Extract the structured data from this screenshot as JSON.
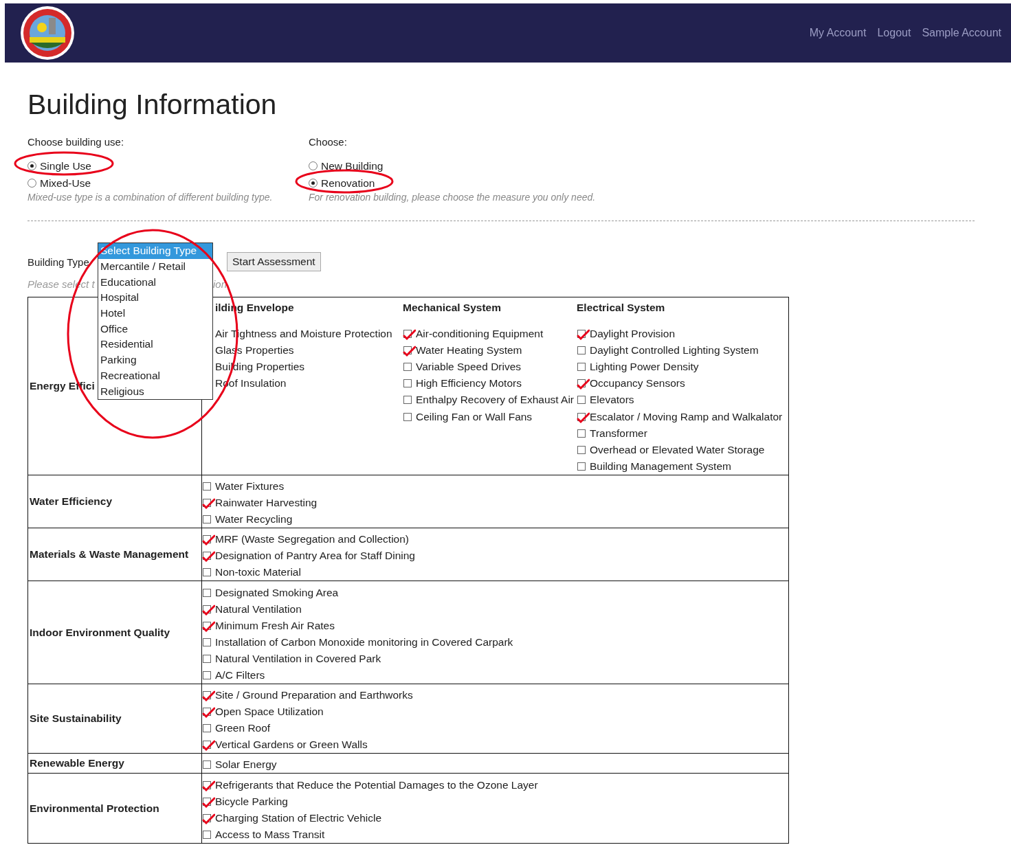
{
  "header": {
    "nav_links": [
      "My Account",
      "Logout",
      "Sample Account"
    ]
  },
  "title": "Building Information",
  "building_use": {
    "label": "Choose building use:",
    "options": [
      {
        "label": "Single Use",
        "selected": true
      },
      {
        "label": "Mixed-Use",
        "selected": false
      }
    ],
    "note": "Mixed-use type is a combination of different building type."
  },
  "project_type": {
    "label": "Choose:",
    "options": [
      {
        "label": "New Building",
        "selected": false
      },
      {
        "label": "Renovation",
        "selected": true
      }
    ],
    "note": "For renovation building, please choose the measure you only need."
  },
  "building_type": {
    "label": "Building Type",
    "button": "Start Assessment",
    "hint_start": "Please select t",
    "hint_end": "ion",
    "dropdown": [
      {
        "label": "Select Building Type",
        "selected": true
      },
      {
        "label": "Mercantile / Retail",
        "selected": false
      },
      {
        "label": "Educational",
        "selected": false
      },
      {
        "label": "Hospital",
        "selected": false
      },
      {
        "label": "Hotel",
        "selected": false
      },
      {
        "label": "Office",
        "selected": false
      },
      {
        "label": "Residential",
        "selected": false
      },
      {
        "label": "Parking",
        "selected": false
      },
      {
        "label": "Recreational",
        "selected": false
      },
      {
        "label": "Religious",
        "selected": false
      }
    ]
  },
  "table": {
    "rows": [
      {
        "category": "Energy Effici",
        "groups": [
          {
            "title": "ilding Envelope",
            "items": [
              {
                "label": "Air Tightness and Moisture Protection"
              },
              {
                "label": "Glass Properties"
              },
              {
                "label": "Building Properties"
              },
              {
                "label": "Roof Insulation"
              }
            ]
          },
          {
            "title": "Mechanical System",
            "items": [
              {
                "label": "Air-conditioning Equipment",
                "checked": true
              },
              {
                "label": "Water Heating System",
                "checked": true
              },
              {
                "label": "Variable Speed Drives",
                "checked": false
              },
              {
                "label": "High Efficiency Motors",
                "checked": false
              },
              {
                "label": "Enthalpy Recovery of Exhaust Air",
                "checked": false
              },
              {
                "label": "Ceiling Fan or Wall Fans",
                "checked": false
              }
            ]
          },
          {
            "title": "Electrical System",
            "items": [
              {
                "label": "Daylight Provision",
                "checked": true
              },
              {
                "label": "Daylight Controlled Lighting System",
                "checked": false
              },
              {
                "label": "Lighting Power Density",
                "checked": false
              },
              {
                "label": "Occupancy Sensors",
                "checked": true
              },
              {
                "label": "Elevators",
                "checked": false
              },
              {
                "label": "Escalator / Moving Ramp and Walkalator",
                "checked": true
              },
              {
                "label": "Transformer",
                "checked": false
              },
              {
                "label": "Overhead or Elevated Water Storage",
                "checked": false
              },
              {
                "label": "Building Management System",
                "checked": false
              }
            ]
          }
        ]
      },
      {
        "category": "Water Efficiency",
        "items": [
          {
            "label": "Water Fixtures",
            "checked": false
          },
          {
            "label": "Rainwater Harvesting",
            "checked": true
          },
          {
            "label": "Water Recycling",
            "checked": false
          }
        ]
      },
      {
        "category": "Materials & Waste Management",
        "items": [
          {
            "label": "MRF (Waste Segregation and Collection)",
            "checked": true
          },
          {
            "label": "Designation of Pantry Area for Staff Dining",
            "checked": true
          },
          {
            "label": "Non-toxic Material",
            "checked": false
          }
        ]
      },
      {
        "category": "Indoor Environment Quality",
        "items": [
          {
            "label": "Designated Smoking Area",
            "checked": false
          },
          {
            "label": "Natural Ventilation",
            "checked": true
          },
          {
            "label": "Minimum Fresh Air Rates",
            "checked": true
          },
          {
            "label": "Installation of Carbon Monoxide monitoring in Covered Carpark",
            "checked": false
          },
          {
            "label": "Natural Ventilation in Covered Park",
            "checked": false
          },
          {
            "label": "A/C Filters",
            "checked": false
          }
        ]
      },
      {
        "category": "Site Sustainability",
        "items": [
          {
            "label": "Site / Ground Preparation and Earthworks",
            "checked": true
          },
          {
            "label": "Open Space Utilization",
            "checked": true
          },
          {
            "label": "Green Roof",
            "checked": false
          },
          {
            "label": "Vertical Gardens or Green Walls",
            "checked": true
          }
        ]
      },
      {
        "category": "Renewable Energy",
        "items": [
          {
            "label": "Solar Energy",
            "checked": false
          }
        ]
      },
      {
        "category": "Environmental Protection",
        "items": [
          {
            "label": "Refrigerants that Reduce the Potential Damages to the Ozone Layer",
            "checked": true
          },
          {
            "label": "Bicycle Parking",
            "checked": true
          },
          {
            "label": "Charging Station of Electric Vehicle",
            "checked": true
          },
          {
            "label": "Access to Mass Transit",
            "checked": false
          }
        ]
      }
    ]
  }
}
